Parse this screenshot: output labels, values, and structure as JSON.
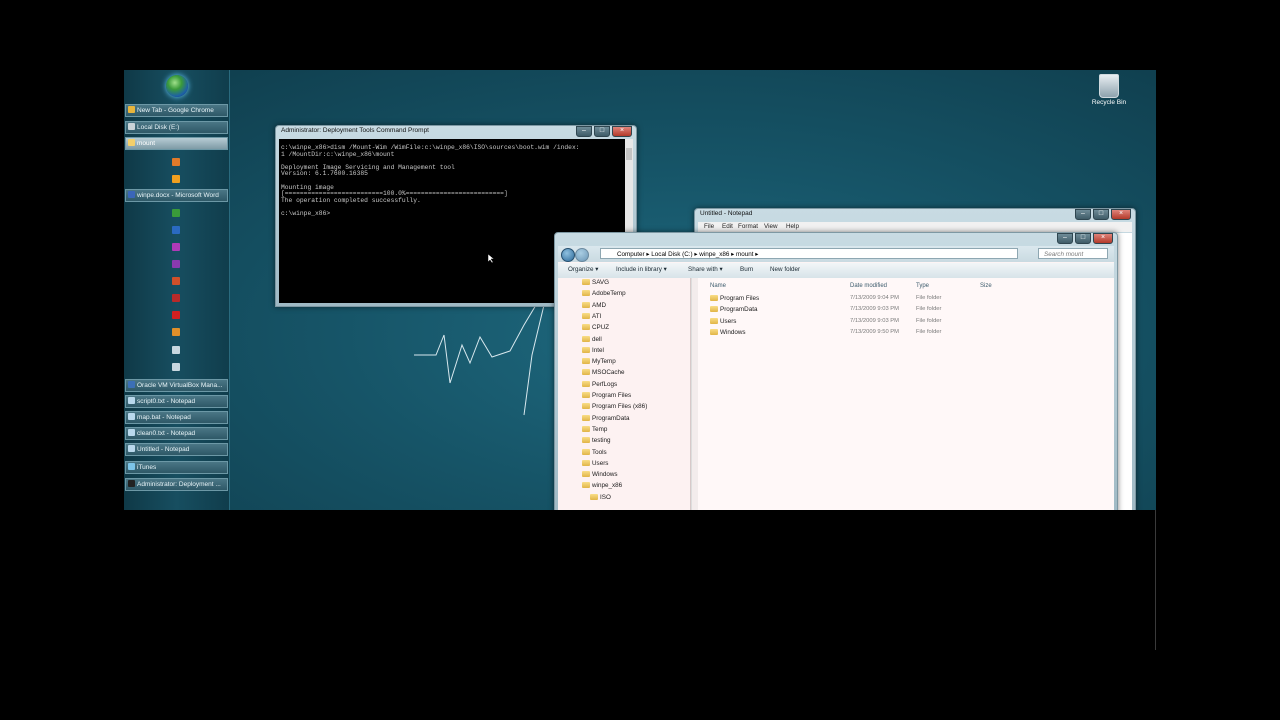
{
  "taskbar": {
    "items": [
      {
        "label": "New Tab - Google Chrome",
        "icon": "chrome-icon",
        "color": "#e8b53c",
        "active": false
      },
      {
        "label": "Local Disk (E:)",
        "icon": "drive-icon",
        "color": "#c9d3d8",
        "active": false
      },
      {
        "label": "mount",
        "icon": "folder-icon",
        "color": "#f3cf6a",
        "active": true
      },
      {
        "label": "winpe.docx - Microsoft Word",
        "icon": "word-icon",
        "color": "#3a66b8",
        "active": false
      },
      {
        "label": "Oracle VM VirtualBox Mana...",
        "icon": "virtualbox-icon",
        "color": "#3b6fb6",
        "active": false
      },
      {
        "label": "script0.txt - Notepad",
        "icon": "notepad-icon",
        "color": "#b9d8ec",
        "active": false
      },
      {
        "label": "map.bat - Notepad",
        "icon": "notepad-icon",
        "color": "#b9d8ec",
        "active": false
      },
      {
        "label": "clean0.txt - Notepad",
        "icon": "notepad-icon",
        "color": "#b9d8ec",
        "active": false
      },
      {
        "label": "Untitled - Notepad",
        "icon": "notepad-icon",
        "color": "#b9d8ec",
        "active": false
      },
      {
        "label": "iTunes",
        "icon": "itunes-icon",
        "color": "#7cc4e8",
        "active": false
      },
      {
        "label": "Administrator: Deployment ...",
        "icon": "cmd-icon",
        "color": "#222222",
        "active": false
      }
    ],
    "tray_icons": [
      {
        "name": "firefox-icon",
        "color": "#e07a2a"
      },
      {
        "name": "vlc-icon",
        "color": "#f0a020"
      },
      {
        "name": "excel-icon",
        "color": "#3a9a3a"
      },
      {
        "name": "outlook-icon",
        "color": "#2a6ac0"
      },
      {
        "name": "onenote-icon",
        "color": "#b03ab8"
      },
      {
        "name": "onenote-icon",
        "color": "#8a3ab0"
      },
      {
        "name": "powerpoint-icon",
        "color": "#d0502a"
      },
      {
        "name": "access-icon",
        "color": "#b82a2a"
      },
      {
        "name": "acrobat-icon",
        "color": "#d02020"
      },
      {
        "name": "sticky-icon",
        "color": "#e0902a"
      },
      {
        "name": "clock-icon",
        "color": "#c8d8e0"
      },
      {
        "name": "globe-icon",
        "color": "#c8d8e0"
      }
    ]
  },
  "desktop": {
    "recycle_bin_label": "Recycle Bin"
  },
  "cmd": {
    "title": "Administrator: Deployment Tools Command Prompt",
    "lines": "c:\\winpe_x86>dism /Mount-Wim /WimFile:c:\\winpe_x86\\ISO\\sources\\boot.wim /index:\n1 /MountDir:c:\\winpe_x86\\mount\n\nDeployment Image Servicing and Management tool\nVersion: 6.1.7600.16385\n\nMounting image\n[==========================100.0%==========================]\nThe operation completed successfully.\n\nc:\\winpe_x86>"
  },
  "notepad": {
    "title": "Untitled - Notepad",
    "menu": [
      "File",
      "Edit",
      "Format",
      "View",
      "Help"
    ]
  },
  "explorer": {
    "breadcrumb": "Computer ▸ Local Disk (C:) ▸ winpe_x86 ▸ mount ▸",
    "search_placeholder": "Search mount",
    "toolbar": [
      "Organize ▾",
      "Include in library ▾",
      "Share with ▾",
      "Burn",
      "New folder"
    ],
    "nav_items": [
      "SAVG",
      "AdobeTemp",
      "AMD",
      "ATI",
      "CPUZ",
      "dell",
      "Intel",
      "MyTemp",
      "MSOCache",
      "PerfLogs",
      "Program Files",
      "Program Files (x86)",
      "ProgramData",
      "Temp",
      "testing",
      "Tools",
      "Users",
      "Windows",
      "winpe_x86",
      "ISO"
    ],
    "columns": [
      "Name",
      "Date modified",
      "Type",
      "Size"
    ],
    "files": [
      {
        "name": "Program Files",
        "date": "7/13/2009 9:04 PM",
        "type": "File folder"
      },
      {
        "name": "ProgramData",
        "date": "7/13/2009 9:03 PM",
        "type": "File folder"
      },
      {
        "name": "Users",
        "date": "7/13/2009 9:03 PM",
        "type": "File folder"
      },
      {
        "name": "Windows",
        "date": "7/13/2009 9:50 PM",
        "type": "File folder"
      }
    ]
  }
}
